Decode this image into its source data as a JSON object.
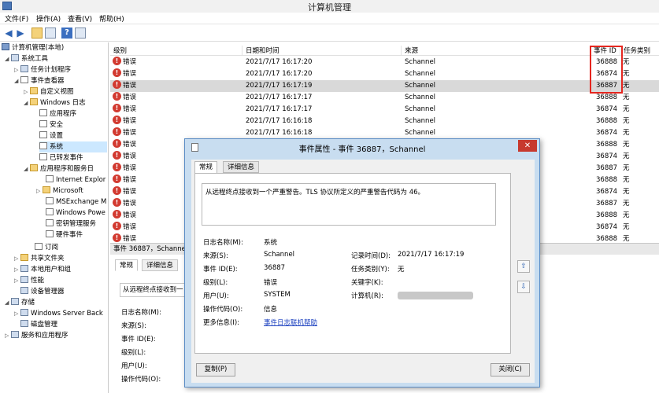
{
  "window": {
    "title": "计算机管理"
  },
  "menu": [
    "文件(F)",
    "操作(A)",
    "查看(V)",
    "帮助(H)"
  ],
  "toolbar": {
    "icons": [
      "back-arrow-icon",
      "forward-arrow-icon",
      "up-folder-icon",
      "show-tree-icon",
      "help-icon",
      "properties-icon"
    ],
    "help_glyph": "?"
  },
  "tree": [
    {
      "label": "计算机管理(本地)",
      "icon": "computer"
    },
    {
      "label": "系统工具",
      "icon": "tools"
    },
    {
      "label": "任务计划程序",
      "icon": "clock"
    },
    {
      "label": "事件查看器",
      "icon": "log"
    },
    {
      "label": "自定义视图",
      "icon": "folder"
    },
    {
      "label": "Windows 日志",
      "icon": "folder"
    },
    {
      "label": "应用程序",
      "icon": "log"
    },
    {
      "label": "安全",
      "icon": "log"
    },
    {
      "label": "设置",
      "icon": "log"
    },
    {
      "label": "系统",
      "icon": "log"
    },
    {
      "label": "已转发事件",
      "icon": "log"
    },
    {
      "label": "应用程序和服务日",
      "icon": "folder"
    },
    {
      "label": "Internet Explor",
      "icon": "log"
    },
    {
      "label": "Microsoft",
      "icon": "folder"
    },
    {
      "label": "MSExchange M",
      "icon": "log"
    },
    {
      "label": "Windows Powe",
      "icon": "log"
    },
    {
      "label": "密钥管理服务",
      "icon": "log"
    },
    {
      "label": "硬件事件",
      "icon": "log"
    },
    {
      "label": "订阅",
      "icon": "log"
    },
    {
      "label": "共享文件夹",
      "icon": "folder"
    },
    {
      "label": "本地用户和组",
      "icon": "users"
    },
    {
      "label": "性能",
      "icon": "perf"
    },
    {
      "label": "设备管理器",
      "icon": "device"
    },
    {
      "label": "存储",
      "icon": "storage"
    },
    {
      "label": "Windows Server Back",
      "icon": "backup"
    },
    {
      "label": "磁盘管理",
      "icon": "disk"
    },
    {
      "label": "服务和应用程序",
      "icon": "services"
    }
  ],
  "columns": {
    "level": "级别",
    "datetime": "日期和时间",
    "source": "来源",
    "event_id": "事件 ID",
    "category": "任务类别"
  },
  "rows": [
    {
      "level": "错误",
      "datetime": "2021/7/17 16:17:20",
      "source": "Schannel",
      "event_id": "36888",
      "category": "无"
    },
    {
      "level": "错误",
      "datetime": "2021/7/17 16:17:20",
      "source": "Schannel",
      "event_id": "36874",
      "category": "无"
    },
    {
      "level": "错误",
      "datetime": "2021/7/17 16:17:19",
      "source": "Schannel",
      "event_id": "36887",
      "category": "无"
    },
    {
      "level": "错误",
      "datetime": "2021/7/17 16:17:17",
      "source": "Schannel",
      "event_id": "36888",
      "category": "无"
    },
    {
      "level": "错误",
      "datetime": "2021/7/17 16:17:17",
      "source": "Schannel",
      "event_id": "36874",
      "category": "无"
    },
    {
      "level": "错误",
      "datetime": "2021/7/17 16:16:18",
      "source": "Schannel",
      "event_id": "36888",
      "category": "无"
    },
    {
      "level": "错误",
      "datetime": "2021/7/17 16:16:18",
      "source": "Schannel",
      "event_id": "36874",
      "category": "无"
    },
    {
      "level": "错误",
      "datetime": "",
      "source": "",
      "event_id": "36888",
      "category": "无"
    },
    {
      "level": "错误",
      "datetime": "",
      "source": "",
      "event_id": "36874",
      "category": "无"
    },
    {
      "level": "错误",
      "datetime": "",
      "source": "",
      "event_id": "36887",
      "category": "无"
    },
    {
      "level": "错误",
      "datetime": "",
      "source": "",
      "event_id": "36888",
      "category": "无"
    },
    {
      "level": "错误",
      "datetime": "",
      "source": "",
      "event_id": "36874",
      "category": "无"
    },
    {
      "level": "错误",
      "datetime": "",
      "source": "",
      "event_id": "36887",
      "category": "无"
    },
    {
      "level": "错误",
      "datetime": "",
      "source": "",
      "event_id": "36888",
      "category": "无"
    },
    {
      "level": "错误",
      "datetime": "",
      "source": "",
      "event_id": "36874",
      "category": "无"
    },
    {
      "level": "错误",
      "datetime": "",
      "source": "",
      "event_id": "36888",
      "category": "无"
    }
  ],
  "selected_row": 2,
  "lower": {
    "header": "事件 36887，Schannel",
    "tabs": [
      "常规",
      "详细信息"
    ],
    "message": "从远程终点接收到一",
    "fields": [
      "日志名称(M):",
      "来源(S):",
      "事件 ID(E):",
      "级别(L):",
      "用户(U):",
      "操作代码(O):"
    ]
  },
  "dialog": {
    "title": "事件属性 - 事件 36887，Schannel",
    "close_glyph": "✕",
    "tabs": [
      "常规",
      "详细信息"
    ],
    "message": "从远程终点接收到一个严重警告。TLS 协议所定义的严重警告代码为 46。",
    "labels": {
      "log_name": "日志名称(M):",
      "source": "来源(S):",
      "event_id": "事件 ID(E):",
      "level": "级别(L):",
      "user": "用户(U):",
      "opcode": "操作代码(O):",
      "more_info": "更多信息(I):",
      "logged": "记录时间(D):",
      "task_category": "任务类别(Y):",
      "keywords": "关键字(K):",
      "computer": "计算机(R):"
    },
    "values": {
      "log_name": "系统",
      "source": "Schannel",
      "event_id": "36887",
      "level": "错误",
      "user": "SYSTEM",
      "opcode": "信息",
      "more_info": "事件日志联机帮助",
      "logged": "2021/7/17 16:17:19",
      "task_category": "无",
      "keywords": "",
      "computer": ""
    },
    "nav_up": "⇧",
    "nav_down": "⇩",
    "copy_button": "复制(P)",
    "close_button": "关闭(C)"
  },
  "colors": {
    "error": "#d23a30",
    "highlight_box": "#e5261f",
    "dialog_frame": "#c8ddf0",
    "link": "#1a3fbf"
  }
}
